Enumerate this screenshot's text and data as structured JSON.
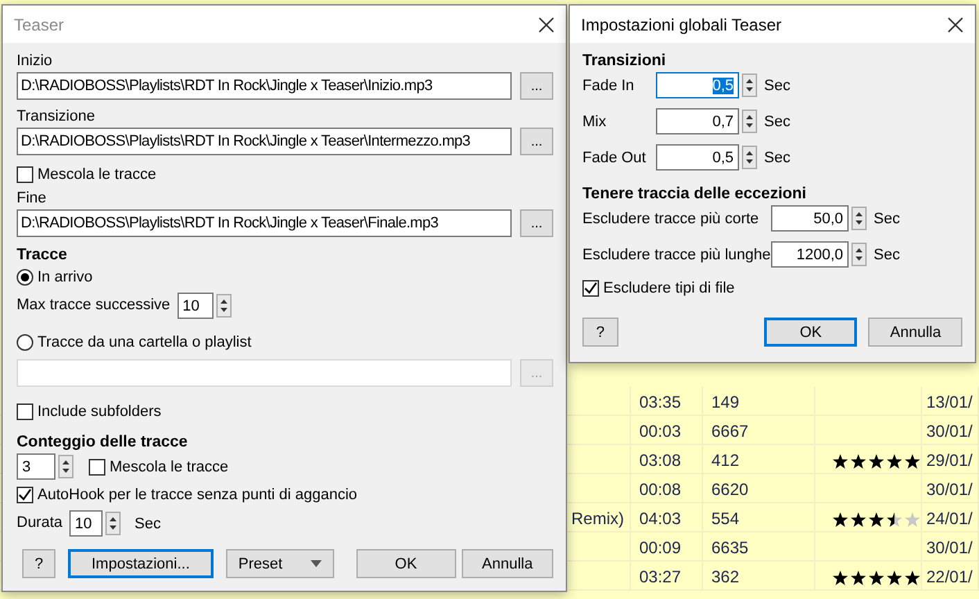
{
  "track_table": {
    "rows": [
      {
        "title": "",
        "time": "03:35",
        "count": "149",
        "date": "13/01/"
      },
      {
        "title": "",
        "time": "00:03",
        "count": "6667",
        "date": "30/01/"
      },
      {
        "title": "",
        "time": "03:08",
        "count": "412",
        "stars": 5,
        "date": "29/01/"
      },
      {
        "title": "",
        "time": "00:08",
        "count": "6620",
        "date": "30/01/"
      },
      {
        "title": "Remix)",
        "time": "04:03",
        "count": "554",
        "stars": 3.5,
        "date": "24/01/"
      },
      {
        "title": "",
        "time": "00:09",
        "count": "6635",
        "date": "30/01/"
      },
      {
        "title": "",
        "time": "03:27",
        "count": "362",
        "stars": 5,
        "date": "22/01/"
      }
    ]
  },
  "teaser_dialog": {
    "title": "Teaser",
    "files": [
      {
        "kind": "path",
        "label": "Inizio",
        "value": "D:\\RADIOBOSS\\Playlists\\RDT In Rock\\Jingle x Teaser\\Inizio.mp3",
        "browse": "..."
      },
      {
        "kind": "path",
        "label": "Transizione",
        "value": "D:\\RADIOBOSS\\Playlists\\RDT In Rock\\Jingle x Teaser\\Intermezzo.mp3",
        "browse": "..."
      },
      {
        "kind": "check",
        "label": "Mescola le tracce",
        "checked": false
      },
      {
        "kind": "path",
        "label": "Fine",
        "value": "D:\\RADIOBOSS\\Playlists\\RDT In Rock\\Jingle x Teaser\\Finale.mp3",
        "browse": "..."
      }
    ],
    "tracks": {
      "heading": "Tracce",
      "incoming": {
        "label": "In arrivo",
        "selected": true
      },
      "max_label": "Max tracce successive",
      "max_value": "10",
      "folder": {
        "label": "Tracce da una cartella o playlist",
        "selected": false
      },
      "folder_browse": {
        "label": "...",
        "disabled": true
      },
      "include_subfolders": {
        "label": "Include subfolders",
        "checked": false
      }
    },
    "count": {
      "heading": "Conteggio delle tracce",
      "value": "3",
      "shuffle": {
        "label": "Mescola le tracce",
        "checked": false
      }
    },
    "autohook": {
      "label": "AutoHook per le tracce senza punti di aggancio",
      "checked": true
    },
    "duration": {
      "label": "Durata",
      "value": "10",
      "unit": "Sec"
    },
    "buttons": [
      {
        "label": "?",
        "dropdown": false,
        "focused": false
      },
      {
        "label": "Impostazioni...",
        "dropdown": false,
        "focused": true
      },
      {
        "label": "Preset",
        "dropdown": true,
        "focused": false
      },
      {
        "label": "OK",
        "dropdown": false,
        "focused": false
      },
      {
        "label": "Annulla",
        "dropdown": false,
        "focused": false
      }
    ]
  },
  "settings_dialog": {
    "title": "Impostazioni globali Teaser",
    "sections": [
      {
        "heading": "Transizioni",
        "kind": "short",
        "rows": [
          {
            "label": "Fade In",
            "value": "0,5",
            "unit": "Sec",
            "selected": true
          },
          {
            "label": "Mix",
            "value": "0,7",
            "unit": "Sec",
            "selected": false
          },
          {
            "label": "Fade Out",
            "value": "0,5",
            "unit": "Sec",
            "selected": false
          }
        ]
      },
      {
        "heading": "Tenere traccia delle eccezioni",
        "kind": "long",
        "rows": [
          {
            "label": "Escludere tracce più corte",
            "value": "50,0",
            "unit": "Sec",
            "selected": false
          },
          {
            "label": "Escludere tracce più lunghe",
            "value": "1200,0",
            "unit": "Sec",
            "selected": false
          }
        ]
      }
    ],
    "exclude_types": {
      "label": "Escludere tipi di file",
      "checked": true
    },
    "buttons": [
      {
        "label": "?",
        "focused": false
      },
      {
        "label": "OK",
        "focused": true
      },
      {
        "label": "Annulla",
        "focused": false
      }
    ]
  }
}
